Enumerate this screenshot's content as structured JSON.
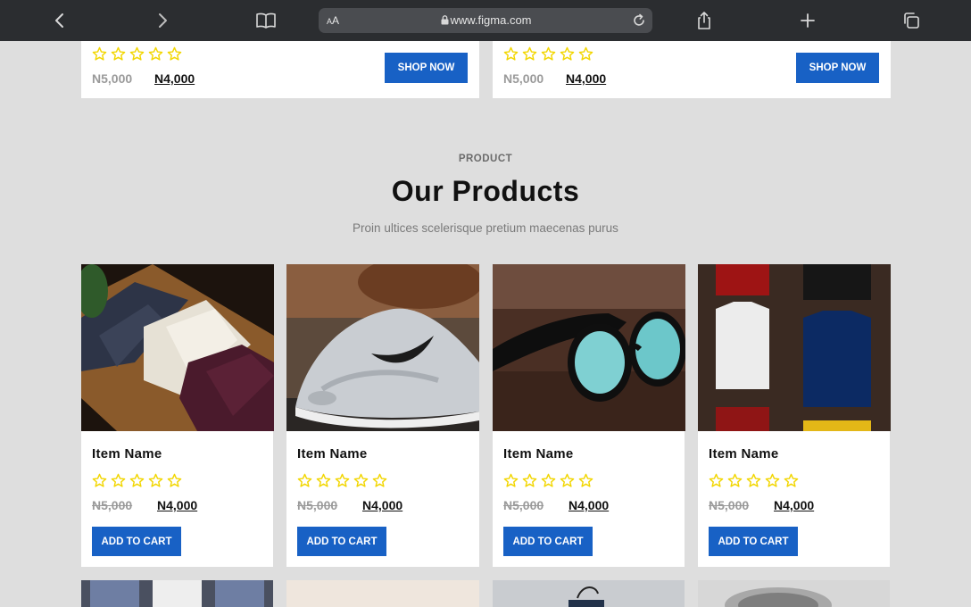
{
  "browser": {
    "aa_label": "AA",
    "url": "www.figma.com"
  },
  "top_cards": [
    {
      "old_price": "N5,000",
      "new_price": "N4,000",
      "button": "SHOP NOW"
    },
    {
      "old_price": "N5,000",
      "new_price": "N4,000",
      "button": "SHOP NOW"
    }
  ],
  "section": {
    "label": "PRODUCT",
    "title": "Our Products",
    "subtitle": "Proin ultices scelerisque pretium maecenas purus"
  },
  "products": [
    {
      "name": "Item Name",
      "old_price": "N5,000",
      "new_price": "N4,000",
      "button": "ADD TO CART",
      "image": "shirts"
    },
    {
      "name": "Item Name",
      "old_price": "N5,000",
      "new_price": "N4,000",
      "button": "ADD TO CART",
      "image": "sneaker"
    },
    {
      "name": "Item Name",
      "old_price": "N5,000",
      "new_price": "N4,000",
      "button": "ADD TO CART",
      "image": "sunglasses"
    },
    {
      "name": "Item Name",
      "old_price": "N5,000",
      "new_price": "N4,000",
      "button": "ADD TO CART",
      "image": "tshirts"
    }
  ],
  "colors": {
    "accent": "#1861c5",
    "star": "#f2d600",
    "background": "#dedede",
    "toolbar": "#2b2d30"
  }
}
